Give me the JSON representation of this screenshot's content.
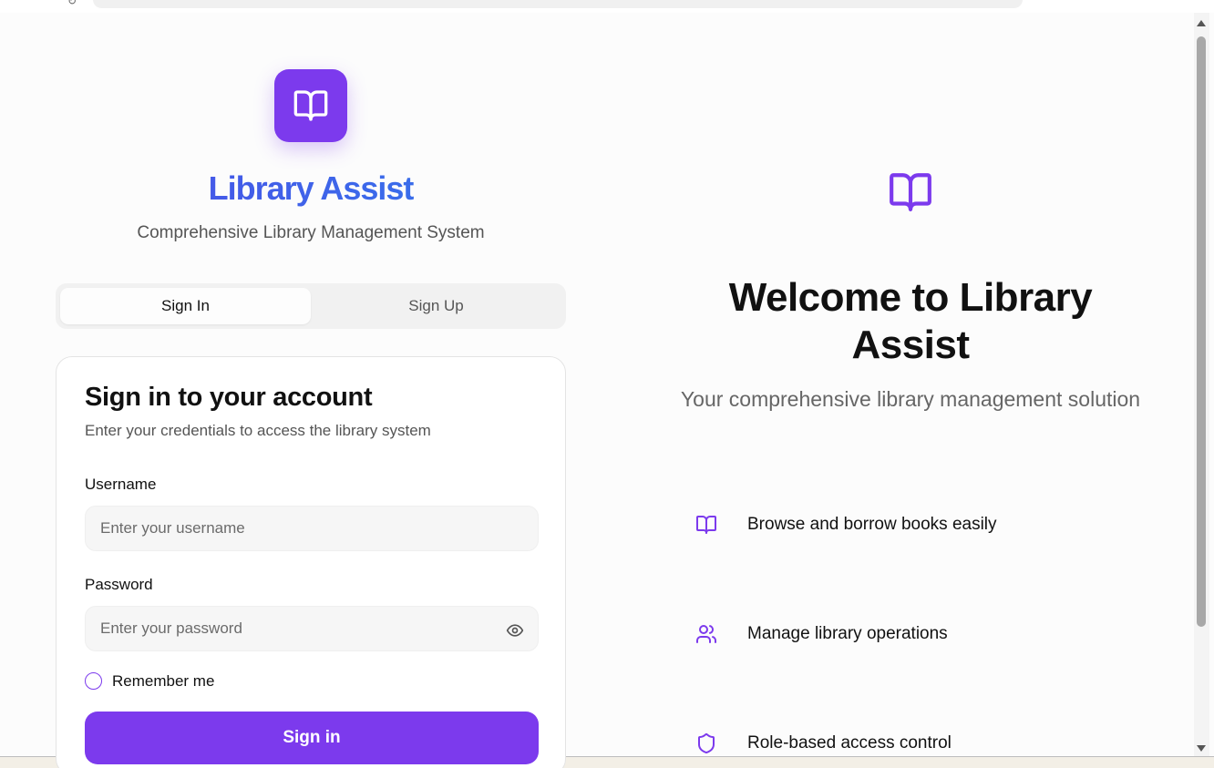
{
  "brand": {
    "title": "Library Assist",
    "subtitle": "Comprehensive Library Management System",
    "icon": "book-open-icon",
    "accent_color": "#7c3aed"
  },
  "tabs": [
    {
      "label": "Sign In",
      "active": true
    },
    {
      "label": "Sign Up",
      "active": false
    }
  ],
  "signin_card": {
    "title": "Sign in to your account",
    "description": "Enter your credentials to access the library system",
    "username": {
      "label": "Username",
      "placeholder": "Enter your username",
      "value": ""
    },
    "password": {
      "label": "Password",
      "placeholder": "Enter your password",
      "value": "",
      "toggle_icon": "eye-icon"
    },
    "remember_label": "Remember me",
    "remember_checked": false,
    "submit_label": "Sign in"
  },
  "hero": {
    "icon": "book-open-icon",
    "title": "Welcome to Library Assist",
    "subtitle": "Your comprehensive library management solution",
    "features": [
      {
        "icon": "book-open-icon",
        "text": "Browse and borrow books easily"
      },
      {
        "icon": "users-icon",
        "text": "Manage library operations"
      },
      {
        "icon": "shield-icon",
        "text": "Role-based access control"
      }
    ]
  }
}
